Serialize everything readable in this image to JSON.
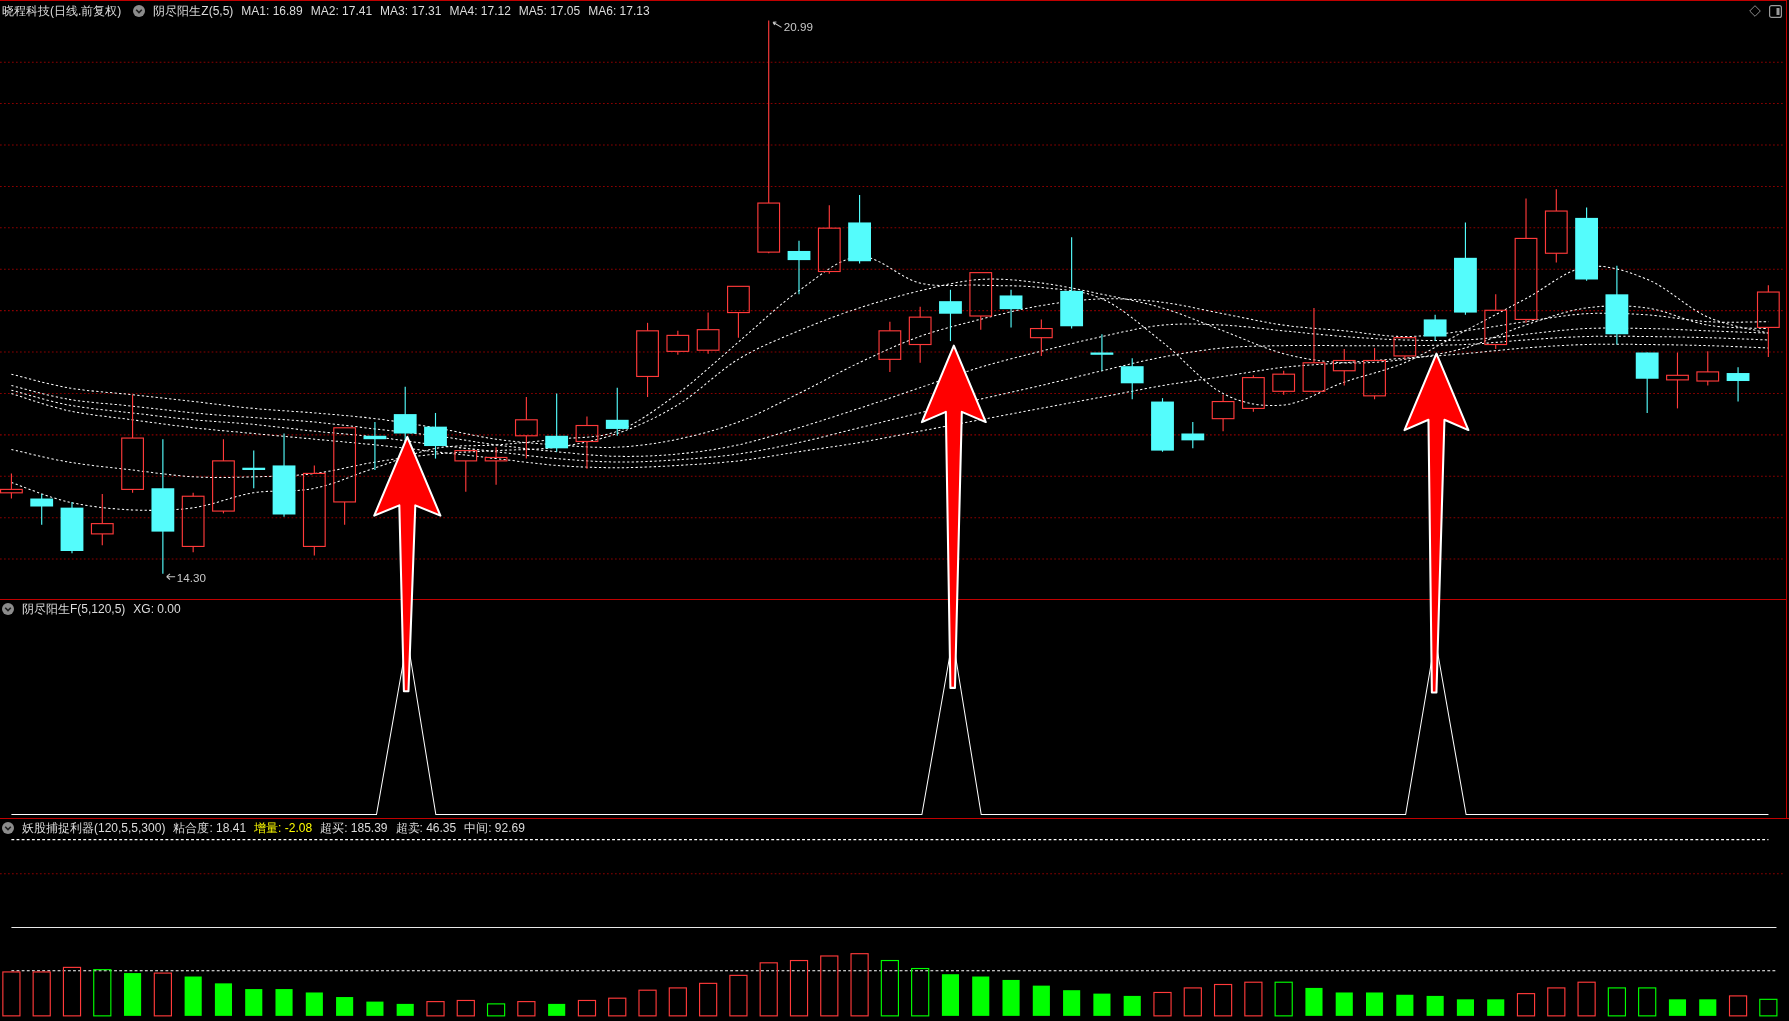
{
  "main_chart": {
    "title": "晓程科技(日线.前复权)",
    "indicator": "阴尽阳生Z(5,5)",
    "readouts": [
      "MA1: 16.89",
      "MA2: 17.41",
      "MA3: 17.31",
      "MA4: 17.12",
      "MA5: 17.05",
      "MA6: 17.13"
    ],
    "high_label": "20.99",
    "low_label": "14.30"
  },
  "signal_panel": {
    "indicator": "阴尽阳生F(5,120,5)",
    "readouts": [
      "XG: 0.00"
    ]
  },
  "oscillator_panel": {
    "indicator": "妖股捕捉利器(120,5,5,300)",
    "readouts": [
      {
        "text": "粘合度: 18.41",
        "color": "#dcdcdc"
      },
      {
        "text": "增量: -2.08",
        "color": "#ffff00"
      },
      {
        "text": "超买: 185.39",
        "color": "#dcdcdc"
      },
      {
        "text": "超卖: 46.35",
        "color": "#dcdcdc"
      },
      {
        "text": "中间: 92.69",
        "color": "#dcdcdc"
      }
    ]
  }
}
